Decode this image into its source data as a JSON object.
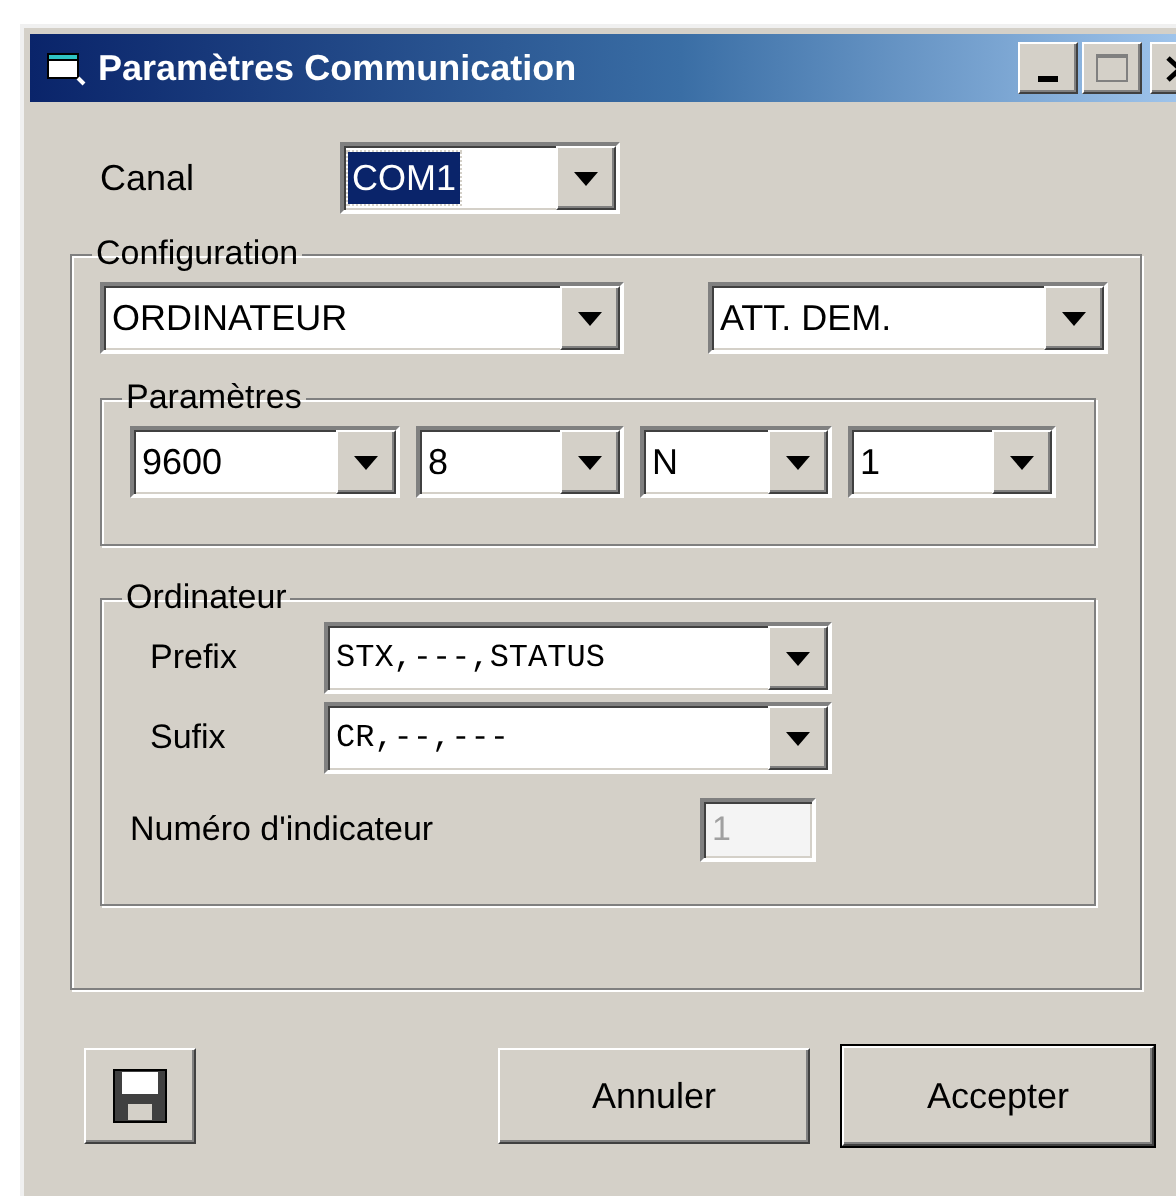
{
  "window": {
    "title": "Paramètres Communication"
  },
  "canal": {
    "label": "Canal",
    "value": "COM1",
    "focused": true
  },
  "configuration": {
    "label": "Configuration",
    "mode": "ORDINATEUR",
    "request": "ATT. DEM.",
    "parametres": {
      "label": "Paramètres",
      "fields": [
        "9600",
        "8",
        "N",
        "1"
      ]
    },
    "ordinateur": {
      "label": "Ordinateur",
      "prefix": {
        "label": "Prefix",
        "value": "STX,---,STATUS"
      },
      "sufix": {
        "label": "Sufix",
        "value": "CR,--,---"
      },
      "indicator": {
        "label": "Numéro d'indicateur",
        "value": "1",
        "disabled": true
      }
    }
  },
  "buttons": [
    {
      "label": "Annuler",
      "default": false
    },
    {
      "label": "Accepter",
      "default": true
    }
  ]
}
